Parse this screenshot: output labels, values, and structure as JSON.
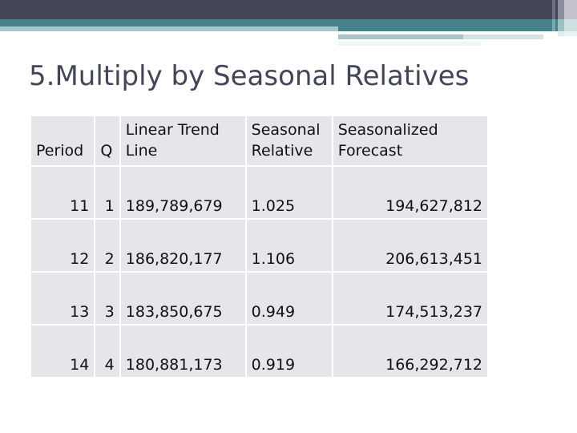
{
  "slide": {
    "title": "5.Multiply by Seasonal Relatives"
  },
  "banner": {
    "dark_color": "#434659",
    "teal_color": "#47818a",
    "light_teal_color": "#a8c4c7",
    "pale_color": "#d3e2e3"
  },
  "table": {
    "headers": [
      {
        "line1": "",
        "line2": "Period"
      },
      {
        "line1": "",
        "line2": "Q"
      },
      {
        "line1": "Linear Trend",
        "line2": "Line"
      },
      {
        "line1": "Seasonal",
        "line2": "Relative"
      },
      {
        "line1": "Seasonalized",
        "line2": "Forecast"
      }
    ],
    "rows": [
      {
        "period": "11",
        "q": "1",
        "trend": "189,789,679",
        "relative": "1.025",
        "forecast": "194,627,812"
      },
      {
        "period": "12",
        "q": "2",
        "trend": "186,820,177",
        "relative": "1.106",
        "forecast": "206,613,451"
      },
      {
        "period": "13",
        "q": "3",
        "trend": "183,850,675",
        "relative": "0.949",
        "forecast": "174,513,237"
      },
      {
        "period": "14",
        "q": "4",
        "trend": "180,881,173",
        "relative": "0.919",
        "forecast": "166,292,712"
      }
    ],
    "cell_background": "#e6e5ea"
  }
}
